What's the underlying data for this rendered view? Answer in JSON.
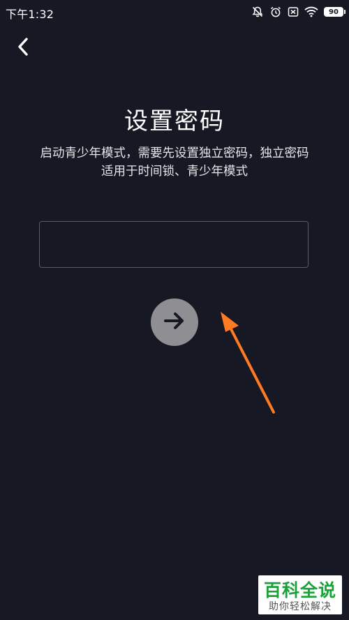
{
  "status_bar": {
    "time": "下午1:32",
    "icons": [
      "mute-icon",
      "alarm-icon",
      "sim-off-icon",
      "wifi-icon"
    ],
    "battery_level": "90"
  },
  "header": {
    "back_icon": "chevron-left-icon"
  },
  "main": {
    "title": "设置密码",
    "description": "启动青少年模式，需要先设置独立密码，独立密码适用于时间锁、青少年模式",
    "password_input": {
      "value": "",
      "placeholder": ""
    },
    "next_button_icon": "arrow-right-icon"
  },
  "annotation": {
    "color": "#ff7a22",
    "type": "arrow"
  },
  "watermark": {
    "title": "百科全说",
    "subtitle": "助你轻松解决"
  },
  "colors": {
    "background": "#161823",
    "text": "#ffffff",
    "button": "#8e8e93",
    "input_border": "#5a5b63",
    "watermark_green": "#1aa13a"
  }
}
